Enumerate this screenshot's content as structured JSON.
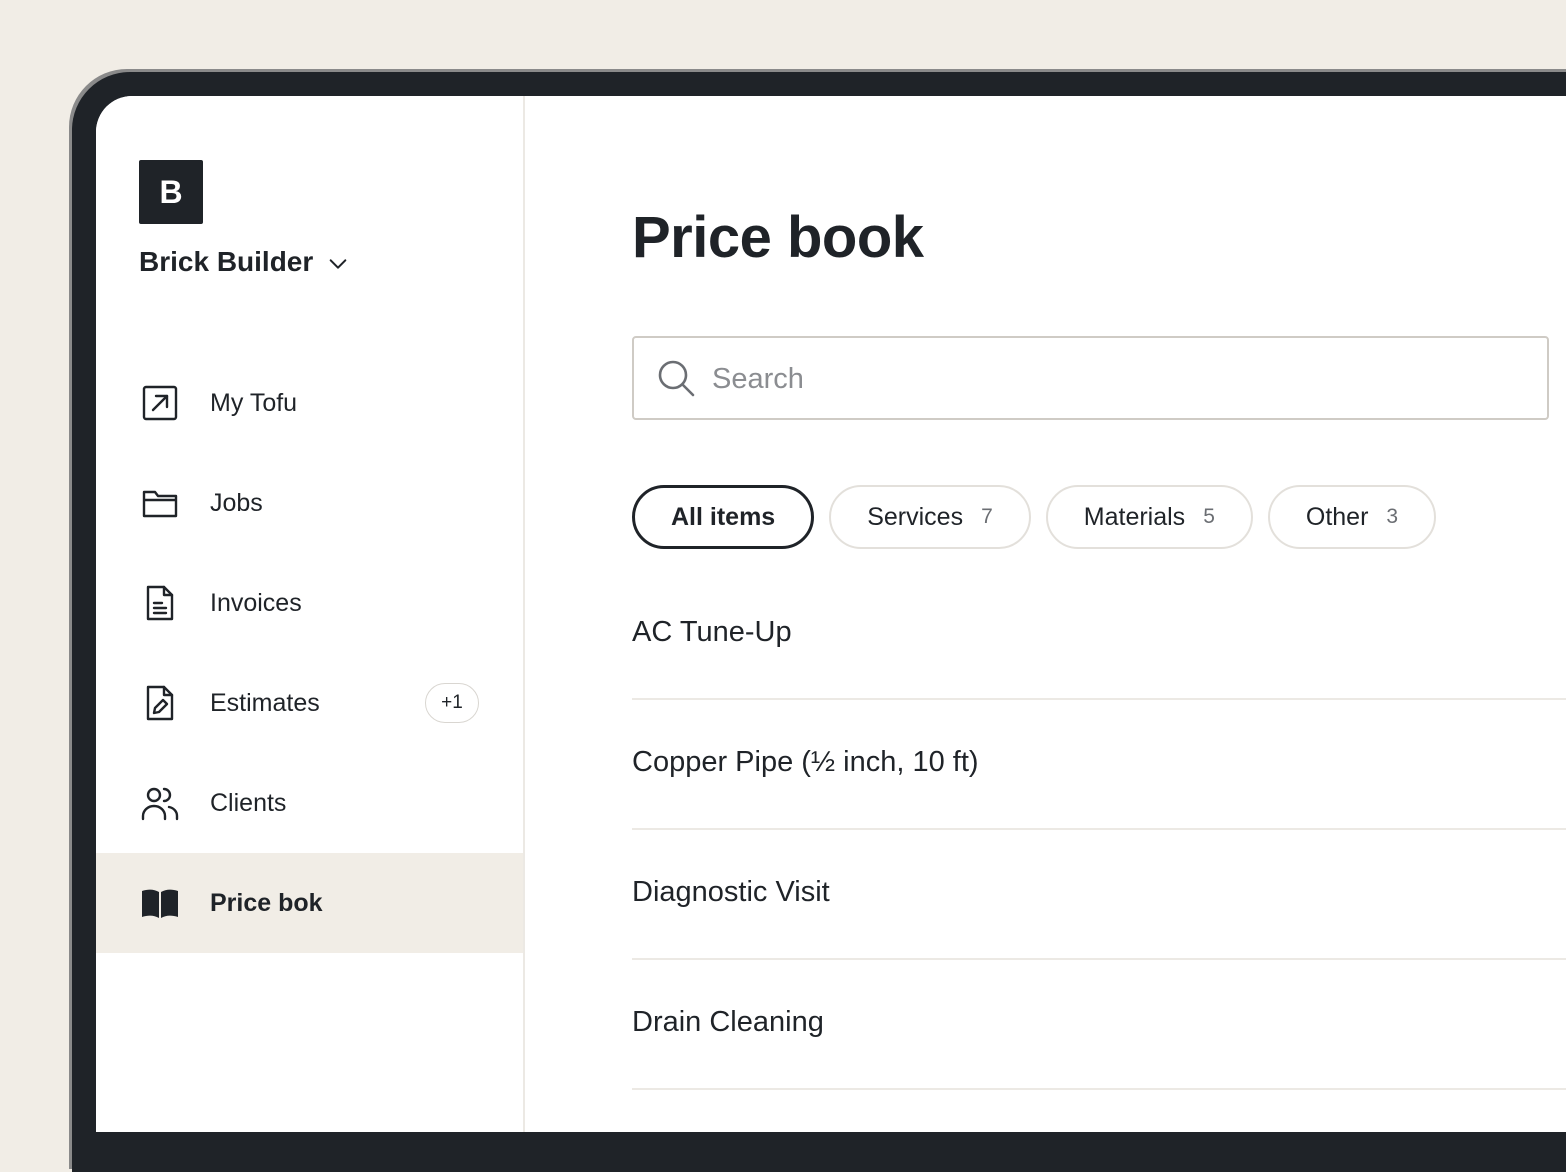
{
  "org": {
    "logo_letter": "B",
    "name": "Brick Builder"
  },
  "sidebar": {
    "items": [
      {
        "label": "My Tofu",
        "icon": "external-link-square-icon"
      },
      {
        "label": "Jobs",
        "icon": "folder-icon"
      },
      {
        "label": "Invoices",
        "icon": "document-icon"
      },
      {
        "label": "Estimates",
        "icon": "document-edit-icon",
        "badge": "+1"
      },
      {
        "label": "Clients",
        "icon": "users-icon"
      },
      {
        "label": "Price bok",
        "icon": "open-book-icon",
        "active": true
      }
    ]
  },
  "main": {
    "title": "Price book",
    "search": {
      "placeholder": "Search",
      "value": ""
    },
    "filters": [
      {
        "label": "All items",
        "count": "",
        "active": true
      },
      {
        "label": "Services",
        "count": "7"
      },
      {
        "label": "Materials",
        "count": "5"
      },
      {
        "label": "Other",
        "count": "3"
      }
    ],
    "items": [
      "AC Tune-Up",
      "Copper Pipe (½ inch, 10 ft)",
      "Diagnostic Visit",
      "Drain Cleaning"
    ]
  },
  "colors": {
    "backdrop": "#f1ede6",
    "device_frame": "#1f2328",
    "active_nav_bg": "#f1ede6",
    "text": "#1f2328",
    "divider": "#ece9e4"
  }
}
